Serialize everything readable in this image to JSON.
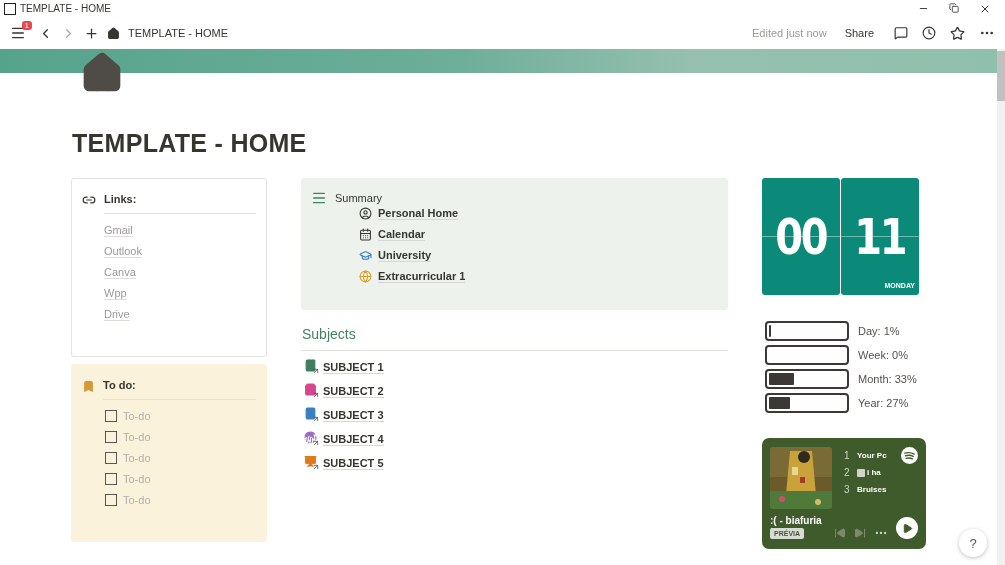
{
  "window": {
    "title": "TEMPLATE - HOME"
  },
  "toolbar": {
    "notifications": "1",
    "breadcrumb": "TEMPLATE - HOME",
    "status": "Edited just now",
    "share": "Share"
  },
  "page": {
    "title": "TEMPLATE - HOME"
  },
  "links": {
    "heading": "Links:",
    "items": [
      "Gmail",
      "Outlook",
      "Canva",
      "Wpp",
      "Drive"
    ]
  },
  "todo": {
    "heading": "To do:",
    "items": [
      {
        "label": "To-do",
        "checked": false
      },
      {
        "label": "To-do",
        "checked": false
      },
      {
        "label": "To-do",
        "checked": false
      },
      {
        "label": "To-do",
        "checked": false
      },
      {
        "label": "To-do",
        "checked": false
      }
    ]
  },
  "summary": {
    "heading": "Summary",
    "items": [
      "Personal Home",
      "Calendar",
      "University",
      "Extracurricular 1"
    ]
  },
  "subjects": {
    "heading": "Subjects",
    "items": [
      {
        "label": "SUBJECT 1",
        "color": "#3f7f5f"
      },
      {
        "label": "SUBJECT 2",
        "color": "#d6478f"
      },
      {
        "label": "SUBJECT 3",
        "color": "#3b7fc0"
      },
      {
        "label": "SUBJECT 4",
        "color": "#9b6bc8"
      },
      {
        "label": "SUBJECT 5",
        "color": "#e07b1c"
      }
    ]
  },
  "clock": {
    "hours": "00",
    "minutes": "11",
    "day": "MONDAY"
  },
  "progress": [
    {
      "label": "Day: 1%",
      "level": 0.01
    },
    {
      "label": "Week: 0%",
      "level": 0
    },
    {
      "label": "Month: 33%",
      "level": 0.33
    },
    {
      "label": "Year: 27%",
      "level": 0.27
    }
  ],
  "player": {
    "tracks": [
      {
        "number": "1",
        "title": "Your Pc",
        "explicit": false
      },
      {
        "number": "2",
        "title": "i ha",
        "explicit": true
      },
      {
        "number": "3",
        "title": "Bruises",
        "explicit": false
      }
    ],
    "artist": ":( - biafuria",
    "badge": "PRÉVIA"
  },
  "help": "?"
}
